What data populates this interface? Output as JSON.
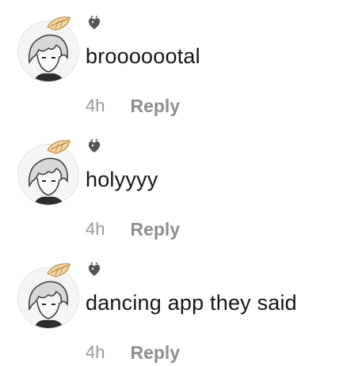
{
  "comments": [
    {
      "avatar_icon": "anime-avatar-icon",
      "username_icon": "heart-badge-icon",
      "text": "brooooootal",
      "time": "4h",
      "reply_label": "Reply"
    },
    {
      "avatar_icon": "anime-avatar-icon",
      "username_icon": "heart-badge-icon",
      "text": "holyyyy",
      "time": "4h",
      "reply_label": "Reply"
    },
    {
      "avatar_icon": "anime-avatar-icon",
      "username_icon": "heart-badge-icon",
      "text": "dancing app they said",
      "time": "4h",
      "reply_label": "Reply"
    }
  ],
  "colors": {
    "text": "#161616",
    "muted": "#9a9a9a",
    "reply": "#8e8e8e",
    "background": "#ffffff"
  }
}
